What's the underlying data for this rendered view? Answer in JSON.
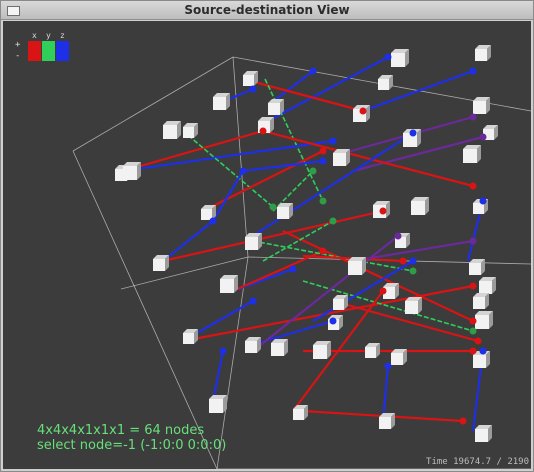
{
  "window": {
    "title": "Source-destination View"
  },
  "legend": {
    "axis_labels": [
      "x",
      "y",
      "z"
    ],
    "plus": "+",
    "minus": "-",
    "colors": {
      "x": "#d81414",
      "y": "#2fcf5a",
      "z": "#1e2fe8"
    }
  },
  "status": {
    "nodes_line": "4x4x4x1x1x1 = 64 nodes",
    "select_line": "select node=-1 (-1:0:0  0:0:0)",
    "time_line": "Time  19674.7 / 2190"
  },
  "scene": {
    "background": "#3c3c3c",
    "link_colors": {
      "x": "#d81414",
      "y": "#2fcf5a",
      "z": "#1e2fe8",
      "mixed": "#6a2a9a"
    }
  }
}
